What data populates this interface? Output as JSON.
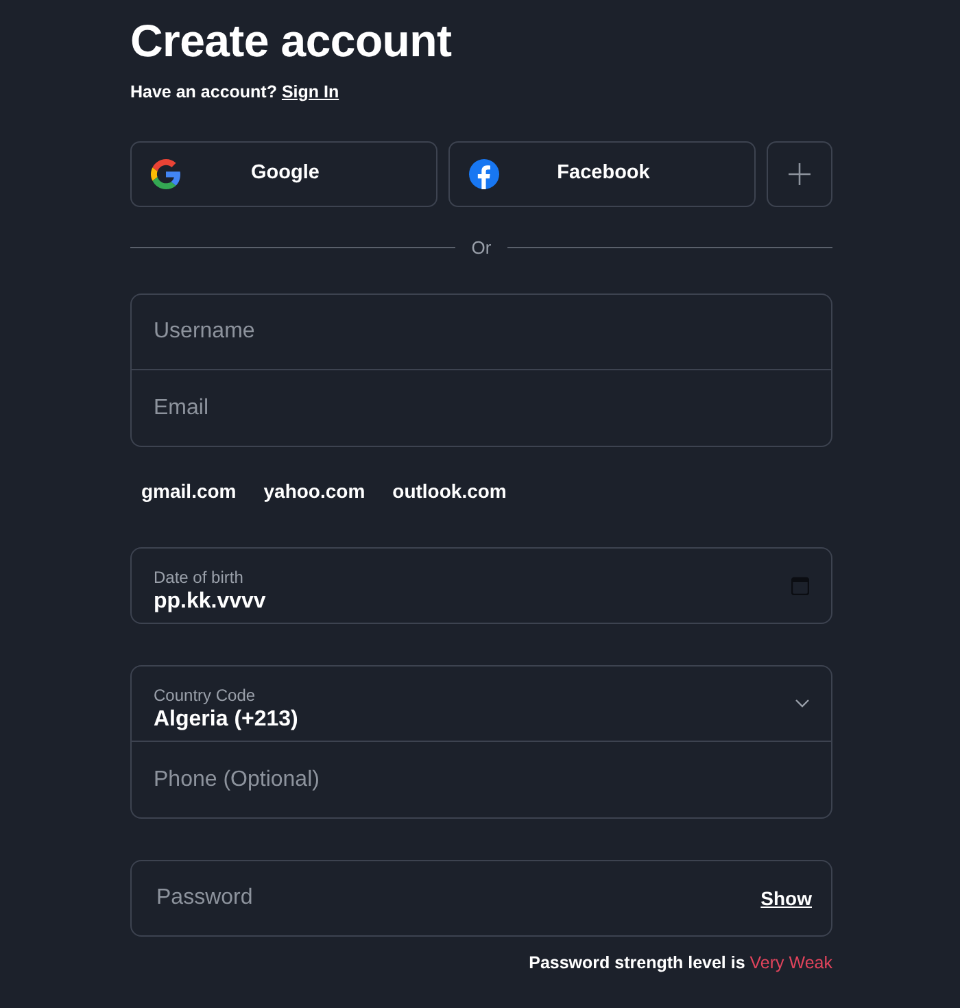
{
  "title": "Create account",
  "signin_prompt": {
    "text": "Have an account?",
    "link": "Sign In"
  },
  "social_buttons": [
    {
      "kind": "google",
      "label": "Google"
    },
    {
      "kind": "facebook",
      "label": "Facebook"
    },
    {
      "kind": "more"
    }
  ],
  "divider": "Or",
  "name_fields": [
    {
      "placeholder": "Username"
    },
    {
      "placeholder": "Email"
    }
  ],
  "email_domains": [
    "gmail.com",
    "yahoo.com",
    "outlook.com"
  ],
  "date_field": {
    "label": "Date of birth",
    "value": "pp.kk.vvvv"
  },
  "country_select": {
    "label": "Country Code",
    "value": "Algeria (+213)"
  },
  "phone_field": {
    "placeholder": "Phone (Optional)"
  },
  "password_field": {
    "placeholder": "Password",
    "toggle": "Show"
  },
  "strength": {
    "label": "Password strength level is",
    "value": "Very Weak"
  }
}
